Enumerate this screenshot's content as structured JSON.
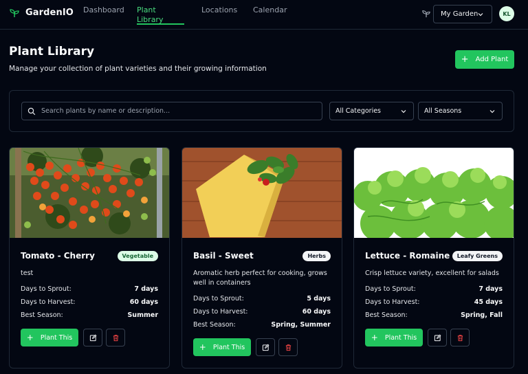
{
  "app": {
    "name": "GardenIO"
  },
  "nav": [
    {
      "label": "Dashboard",
      "active": false
    },
    {
      "label": "Plant Library",
      "active": true
    },
    {
      "label": "Locations",
      "active": false
    },
    {
      "label": "Calendar",
      "active": false
    }
  ],
  "header": {
    "garden_select": "My Garden",
    "avatar_initials": "KL"
  },
  "page": {
    "title": "Plant Library",
    "subtitle": "Manage your collection of plant varieties and their growing information",
    "add_button": "Add Plant"
  },
  "filters": {
    "search_placeholder": "Search plants by name or description...",
    "category": "All Categories",
    "season": "All Seasons"
  },
  "labels": {
    "days_to_sprout": "Days to Sprout:",
    "days_to_harvest": "Days to Harvest:",
    "best_season": "Best Season:",
    "plant_button": "Plant This"
  },
  "plants": [
    {
      "name": "Tomato - Cherry",
      "category": "Vegetable",
      "description": "test",
      "sprout": "7 days",
      "harvest": "60 days",
      "season": "Summer"
    },
    {
      "name": "Basil - Sweet",
      "category": "Herbs",
      "description": "Aromatic herb perfect for cooking, grows well in containers",
      "sprout": "5 days",
      "harvest": "60 days",
      "season": "Spring, Summer"
    },
    {
      "name": "Lettuce - Romaine",
      "category": "Leafy Greens",
      "description": "Crisp lettuce variety, excellent for salads",
      "sprout": "7 days",
      "harvest": "45 days",
      "season": "Spring, Fall"
    }
  ],
  "colors": {
    "accent": "#22c55e",
    "background": "#030712",
    "border": "#1f2937"
  },
  "icons": [
    "sprout-icon",
    "chevron-down-icon",
    "search-icon",
    "plus-icon",
    "edit-icon",
    "trash-icon"
  ]
}
